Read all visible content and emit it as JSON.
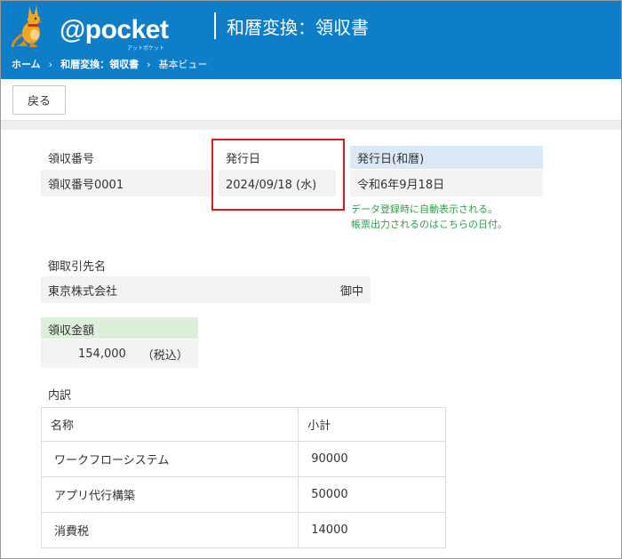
{
  "header": {
    "logo_text": "@pocket",
    "logo_sub": "アットポケット",
    "title": "和暦変換：領収書"
  },
  "breadcrumb": {
    "items": [
      "ホーム",
      "和暦変換：領収書",
      "基本ビュー"
    ],
    "separator": "›"
  },
  "toolbar": {
    "back_label": "戻る"
  },
  "form": {
    "receipt_no": {
      "label": "領収番号",
      "value": "領収番号0001"
    },
    "issue_date": {
      "label": "発行日",
      "value": "2024/09/18 (水)"
    },
    "issue_date_wareki": {
      "label": "発行日(和暦)",
      "value": "令和6年9月18日"
    },
    "notes": [
      "データ登録時に自動表示される。",
      "帳票出力されるのはこちらの日付。"
    ],
    "client": {
      "label": "御取引先名",
      "value": "東京株式会社",
      "suffix": "御中"
    },
    "amount": {
      "label": "領収金額",
      "value": "154,000",
      "tax_note": "（税込）"
    },
    "breakdown": {
      "label": "内訳",
      "columns": [
        "名称",
        "小計"
      ],
      "rows": [
        {
          "name": "ワークフローシステム",
          "subtotal": "90000"
        },
        {
          "name": "アプリ代行構築",
          "subtotal": "50000"
        },
        {
          "name": "消費税",
          "subtotal": "14000"
        }
      ]
    }
  },
  "colors": {
    "header_bg": "#0e7ec8",
    "highlight": "#e01818",
    "note_green": "#2f9e4a",
    "label_blue": "#dbe9f6",
    "label_green": "#dcefd8"
  }
}
